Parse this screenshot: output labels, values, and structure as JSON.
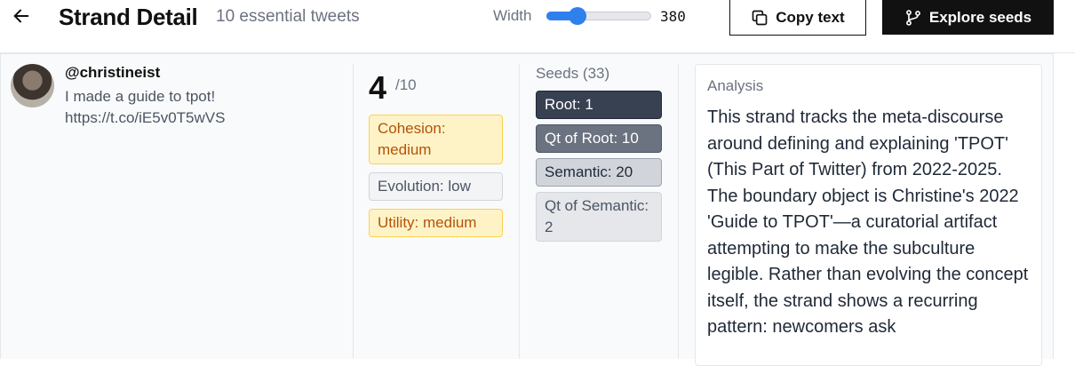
{
  "header": {
    "title": "Strand Detail",
    "subtitle": "10 essential tweets",
    "width_label": "Width",
    "width_value": "380",
    "width_fraction": 0.3,
    "copy_label": "Copy text",
    "explore_label": "Explore seeds",
    "back_icon": "arrow-left-icon",
    "copy_icon": "copy-icon",
    "explore_icon": "git-branch-icon"
  },
  "tweet": {
    "handle": "@christineist",
    "text": "I made a guide to tpot! https://t.co/iE5v0T5wVS"
  },
  "score": {
    "value": "4",
    "denominator": "/10"
  },
  "tags": [
    {
      "label": "Cohesion: medium",
      "tone": "amber"
    },
    {
      "label": "Evolution: low",
      "tone": "gray"
    },
    {
      "label": "Utility: medium",
      "tone": "amber"
    }
  ],
  "seeds": {
    "label": "Seeds (33)",
    "items": [
      {
        "label": "Root: 1"
      },
      {
        "label": "Qt of Root: 10"
      },
      {
        "label": "Semantic: 20"
      },
      {
        "label": "Qt of Semantic: 2"
      }
    ]
  },
  "analysis": {
    "label": "Analysis",
    "text": "This strand tracks the meta-discourse around defining and explaining 'TPOT' (This Part of Twitter) from 2022-2025. The boundary object is Christine's 2022 'Guide to TPOT'—a curatorial artifact attempting to make the subculture legible. Rather than evolving the concept itself, the strand shows a recurring pattern: newcomers ask"
  },
  "colors": {
    "accent": "#2f80ed",
    "amber_bg": "#fef3c7",
    "amber_text": "#b45309"
  }
}
